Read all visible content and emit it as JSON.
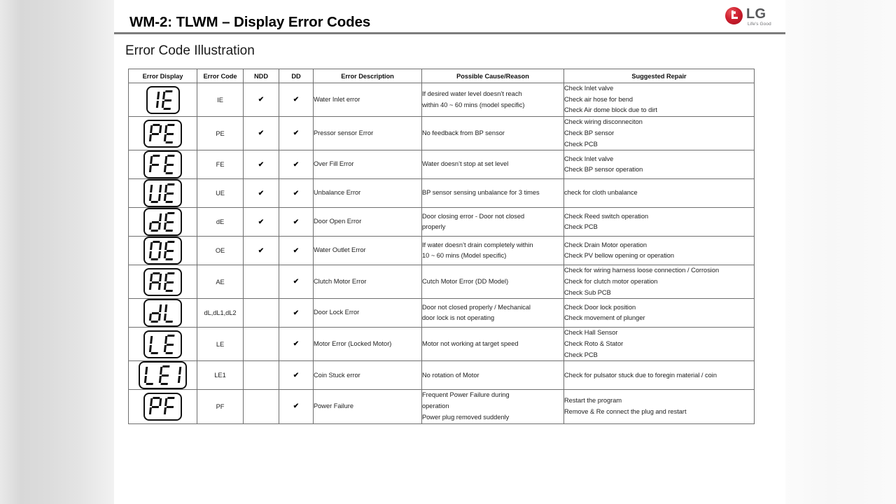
{
  "slide": {
    "title": "WM-2: TLWM – Display Error Codes",
    "subtitle": "Error Code Illustration",
    "logo": {
      "word": "LG",
      "tagline": "Life's Good",
      "brand_color": "#a8121f",
      "word_color": "#58595b"
    },
    "accent_rule_color": "#7d7d7d"
  },
  "table": {
    "headers": [
      "Error Display",
      "Error Code",
      "NDD",
      "DD",
      "Error Description",
      "Possible Cause/Reason",
      "Suggested Repair"
    ],
    "check_glyph": "✔",
    "rows": [
      {
        "display_segments": "1E",
        "code": "IE",
        "ndd": "✔",
        "dd": "✔",
        "description": "Water Inlet error",
        "cause": [
          "If desired water level doesn’t reach",
          "within 40 ~ 60 mins (model specific)"
        ],
        "repair": [
          "Check Inlet valve",
          "Check air hose for bend",
          "Check Air dome block due to dirt"
        ]
      },
      {
        "display_segments": "PE",
        "code": "PE",
        "ndd": "✔",
        "dd": "✔",
        "description": "Pressor sensor Error",
        "cause": [
          "No feedback from BP sensor"
        ],
        "repair": [
          "Check wiring disconneciton",
          "Check BP sensor",
          "Check PCB"
        ]
      },
      {
        "display_segments": "FE",
        "code": "FE",
        "ndd": "✔",
        "dd": "✔",
        "description": "Over Fill Error",
        "cause": [
          "Water doesn’t stop at set level"
        ],
        "repair": [
          "Check Inlet valve",
          "Check BP sensor operation"
        ]
      },
      {
        "display_segments": "UE",
        "code": "UE",
        "ndd": "✔",
        "dd": "✔",
        "description": "Unbalance Error",
        "cause": [
          "BP sensor sensing unbalance for 3 times"
        ],
        "repair": [
          "check for cloth unbalance"
        ]
      },
      {
        "display_segments": "dE",
        "code": "dE",
        "ndd": "✔",
        "dd": "✔",
        "description": "Door Open Error",
        "cause": [
          "Door closing error - Door not closed",
          "properly"
        ],
        "repair": [
          "Check Reed switch operation",
          "Check PCB"
        ]
      },
      {
        "display_segments": "OE",
        "code": "OE",
        "ndd": "✔",
        "dd": "✔",
        "description": "Water Outlet Error",
        "cause": [
          "If water doesn’t drain completely within",
          "10 ~ 60 mins (Model specific)"
        ],
        "repair": [
          "Check Drain Motor operation",
          "Check PV bellow opening or operation"
        ]
      },
      {
        "display_segments": "AE",
        "code": "AE",
        "ndd": "",
        "dd": "✔",
        "description": "Clutch Motor Error",
        "cause": [
          "Cutch Motor Error (DD Model)"
        ],
        "repair": [
          "Check for wiring harness loose connection / Corrosion",
          "Check for clutch motor operation",
          "Check Sub PCB"
        ]
      },
      {
        "display_segments": "dL",
        "code": "dL,dL1,dL2",
        "ndd": "",
        "dd": "✔",
        "description": "Door Lock Error",
        "cause": [
          "Door not closed properly / Mechanical",
          "door lock is not operating"
        ],
        "repair": [
          "Check Door lock position",
          "Check movement of plunger"
        ]
      },
      {
        "display_segments": "LE",
        "code": "LE",
        "ndd": "",
        "dd": "✔",
        "description": "Motor Error (Locked Motor)",
        "cause": [
          "Motor not working at target speed"
        ],
        "repair": [
          "Check Hall Sensor",
          "Check Roto & Stator",
          "Check PCB"
        ]
      },
      {
        "display_segments": "LE1",
        "code": "LE1",
        "ndd": "",
        "dd": "✔",
        "description": "Coin Stuck error",
        "cause": [
          "No rotation of Motor"
        ],
        "repair": [
          "Check for pulsator stuck due to foregin material / coin"
        ]
      },
      {
        "display_segments": "PF",
        "code": "PF",
        "ndd": "",
        "dd": "✔",
        "description": "Power Failure",
        "cause": [
          "Frequent Power Failure during",
          "operation",
          "Power plug removed suddenly"
        ],
        "repair": [
          "Restart the program",
          "Remove & Re connect the plug and restart"
        ]
      }
    ]
  }
}
